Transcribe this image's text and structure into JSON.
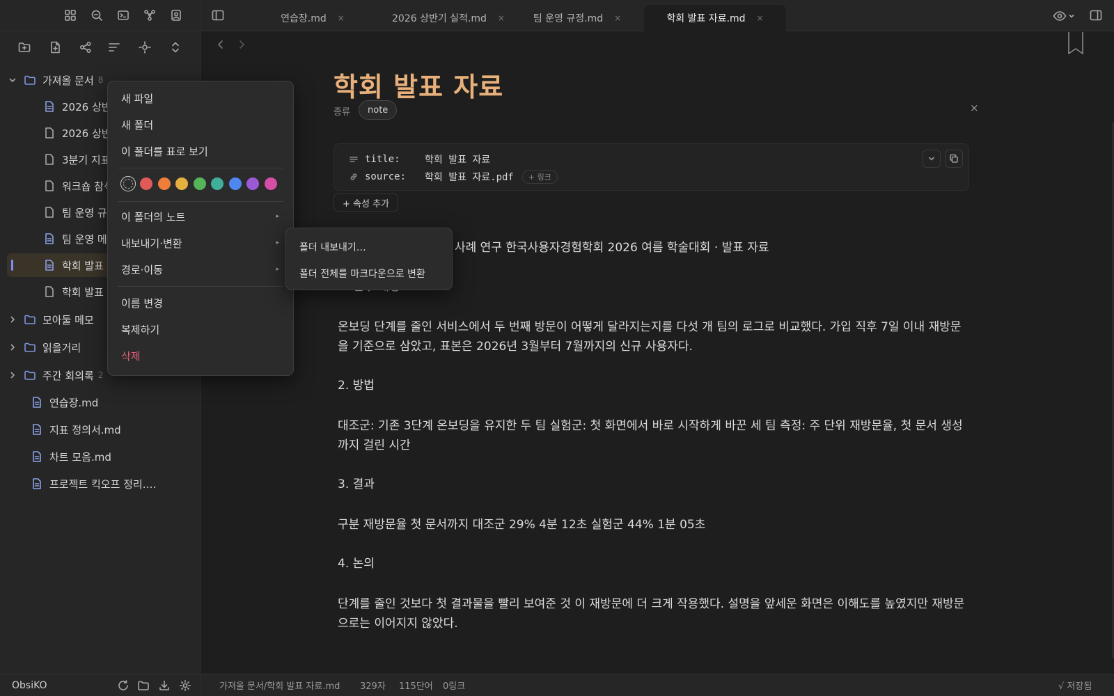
{
  "app": {
    "vault_name": "ObsiKO"
  },
  "tabs": [
    {
      "label": "연습장.md",
      "close": "×"
    },
    {
      "label": "2026 상반기 실적.md",
      "close": "×"
    },
    {
      "label": "팀 운영 규정.md",
      "close": "×"
    },
    {
      "label": "학회 발표 자료.md",
      "close": "×"
    }
  ],
  "tree": {
    "folder_import": {
      "label": "가져올 문서",
      "count": "8"
    },
    "import_children": [
      {
        "label": "2026 상반기 실적.md"
      },
      {
        "label": "2026 상반기 계획.md"
      },
      {
        "label": "3분기 지표.md"
      },
      {
        "label": "워크숍 참석자.md"
      },
      {
        "label": "팀 운영 규정.md"
      },
      {
        "label": "팀 운영 메모.md"
      },
      {
        "label": "학회 발표 자료.md"
      },
      {
        "label": "학회 발표 초안.md"
      }
    ],
    "folders": [
      {
        "label": "모아둘 메모",
        "count": ""
      },
      {
        "label": "읽을거리",
        "count": ""
      },
      {
        "label": "주간 회의록",
        "count": "2"
      }
    ],
    "root_files": [
      {
        "label": "연습장.md"
      },
      {
        "label": "지표 정의서.md"
      },
      {
        "label": "차트 모음.md"
      },
      {
        "label": "프로젝트 킥오프 정리.…"
      }
    ]
  },
  "context_menu": {
    "new_file": "새 파일",
    "new_folder": "새 폴더",
    "view_as_table": "이 폴더를 표로 보기",
    "notes_in_folder": "이 폴더의 노트",
    "export_convert": "내보내기·변환",
    "path_move": "경로·이동",
    "rename": "이름 변경",
    "duplicate": "복제하기",
    "delete": "삭제",
    "arrow": "▸",
    "swatch_colors": [
      "#e05a5a",
      "#ee7f3a",
      "#e4b040",
      "#55b35a",
      "#3fae9a",
      "#4f86f0",
      "#9a5ad6",
      "#d64ea6"
    ]
  },
  "submenu": {
    "export_folder": "폴더 내보내기…",
    "convert_markdown": "폴더 전체를 마크다운으로 변환"
  },
  "note": {
    "title": "학회 발표 자료",
    "kind_label": "종류",
    "kind_value": "note",
    "close": "×",
    "properties": [
      {
        "key": "title:",
        "value": "학회 발표 자료",
        "link": ""
      },
      {
        "key": "source:",
        "value": "학회 발표 자료.pdf",
        "link": "+ 링크"
      }
    ],
    "add_property": "+ 속성 추가",
    "paragraphs": [
      "사례 연구 한국사용자경험학회 2026 여름 학술대회 · 발표 자료",
      "1. 연구 배경",
      "온보딩 단계를 줄인 서비스에서 두 번째 방문이 어떻게 달라지는지를 다섯 개 팀의 로그로 비교했다. 가입 직후 7일 이내 재방문을 기준으로 삼았고, 표본은 2026년 3월부터 7월까지의 신규 사용자다.",
      "2. 방법",
      "대조군: 기존 3단계 온보딩을 유지한 두 팀 실험군: 첫 화면에서 바로 시작하게 바꾼 세 팀 측정: 주 단위 재방문율, 첫 문서 생성까지 걸린 시간",
      "3. 결과",
      "구분 재방문율 첫 문서까지 대조군 29% 4분 12초 실험군 44% 1분 05초",
      "4. 논의",
      "단계를 줄인 것보다 첫 결과물을 빨리 보여준 것 이 재방문에 더 크게 작용했다. 설명을 앞세운 화면은 이해도를 높였지만 재방문으로는 이어지지 않았다."
    ]
  },
  "status": {
    "path": "가져올 문서/학회 발표 자료.md",
    "chars": "329자",
    "words": "115단어",
    "links": "0링크",
    "saved": "√ 저장됨"
  },
  "colors": {
    "accent": "#7c8cf8",
    "title": "#e8b07a",
    "danger": "#e0607a"
  }
}
